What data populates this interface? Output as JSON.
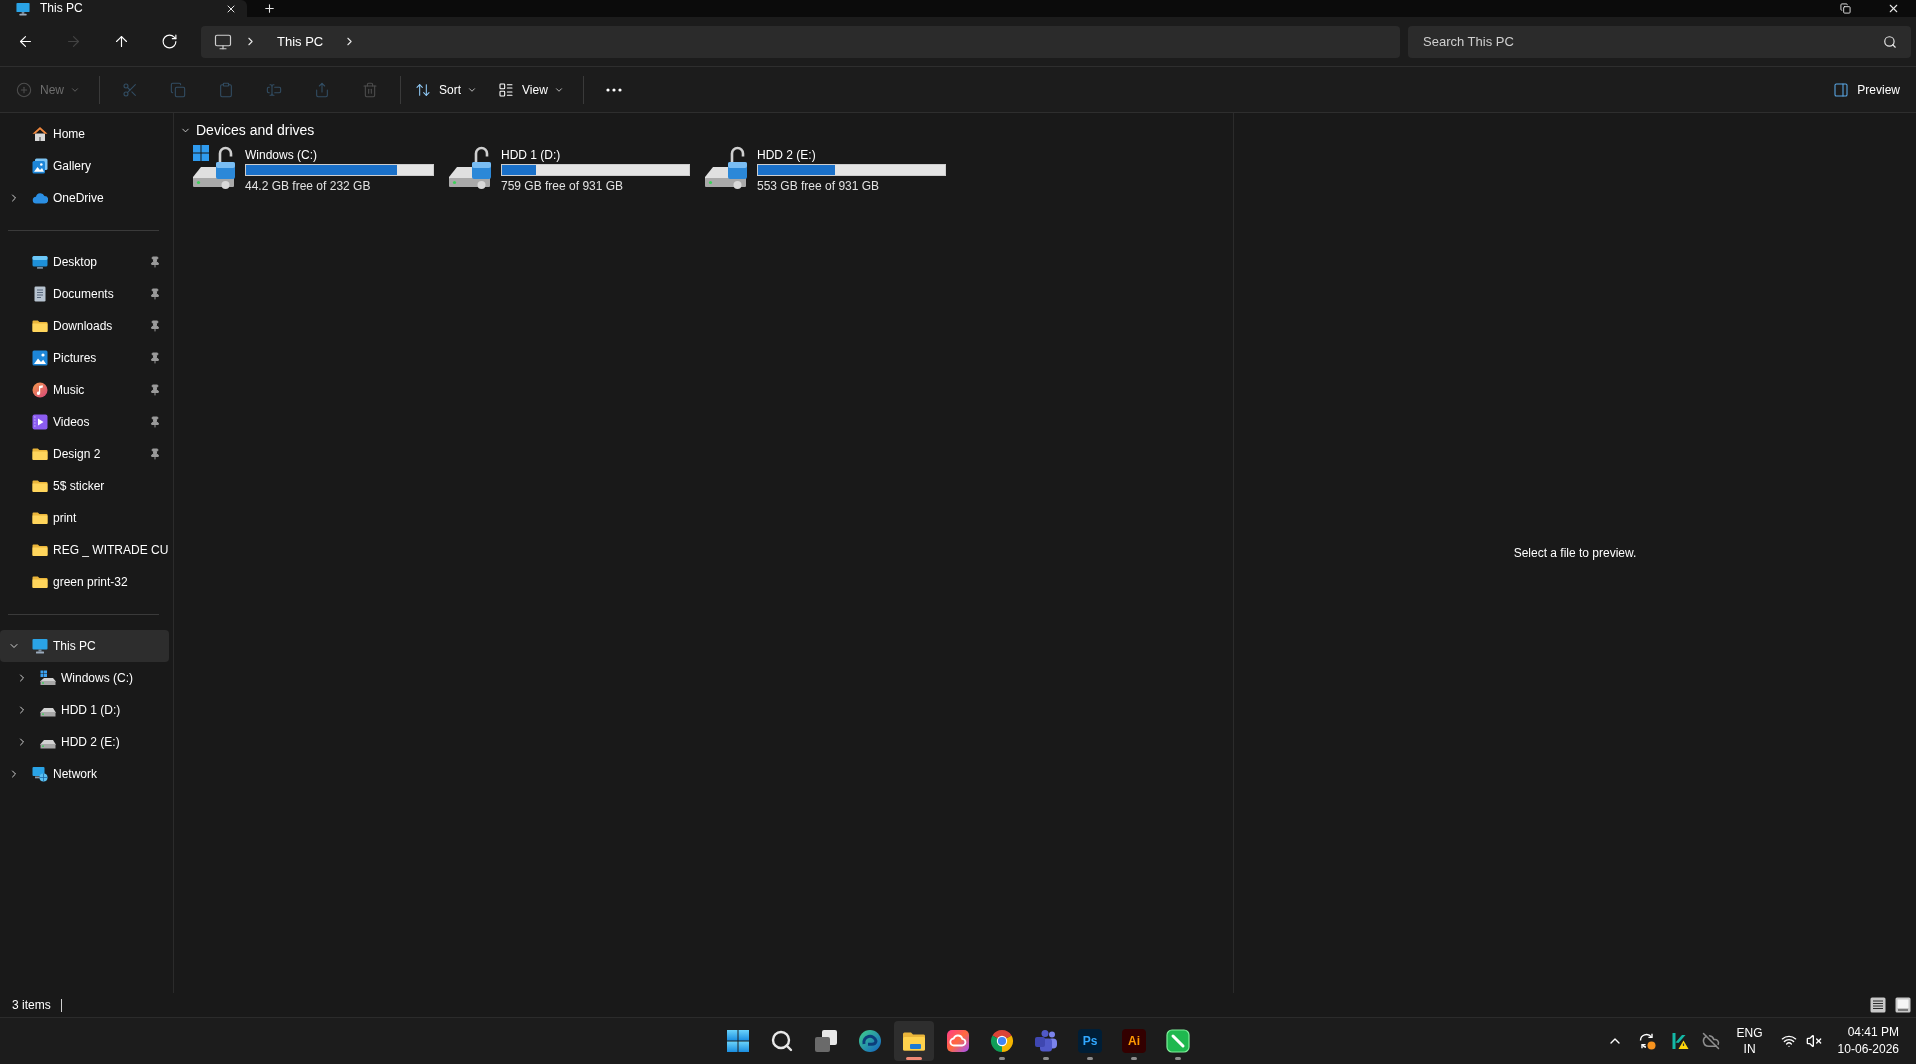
{
  "tabs": [
    {
      "title": "This PC",
      "selected": true
    }
  ],
  "navigation": [
    {
      "kind": "back",
      "disabled": false
    },
    {
      "kind": "forward",
      "disabled": true
    },
    {
      "kind": "up",
      "disabled": false
    },
    {
      "kind": "refresh",
      "disabled": false
    }
  ],
  "address_bar": {
    "segments": [
      "This PC"
    ]
  },
  "search": {
    "placeholder": "Search This PC"
  },
  "toolbar": {
    "items": [
      {
        "kind": "new",
        "label": "New",
        "disabled": true
      },
      {
        "kind": "separator"
      },
      {
        "kind": "cut",
        "disabled": true
      },
      {
        "kind": "copy",
        "disabled": true
      },
      {
        "kind": "paste",
        "disabled": true
      },
      {
        "kind": "rename",
        "disabled": true
      },
      {
        "kind": "share",
        "disabled": true
      },
      {
        "kind": "delete",
        "disabled": true
      },
      {
        "kind": "separator"
      },
      {
        "kind": "sort",
        "label": "Sort",
        "disabled": false
      },
      {
        "kind": "view",
        "label": "View",
        "disabled": false
      },
      {
        "kind": "separator"
      },
      {
        "kind": "more",
        "disabled": false
      }
    ],
    "preview": {
      "label": "Preview",
      "on": true
    }
  },
  "sidebar": {
    "sections": [
      {
        "items": [
          {
            "label": "Home",
            "kind": "home",
            "selected": false
          },
          {
            "label": "Gallery",
            "kind": "gallery",
            "selected": false
          },
          {
            "label": "OneDrive",
            "kind": "cloud",
            "expanded": false,
            "selected": false
          }
        ]
      },
      {
        "items": [
          {
            "label": "Desktop",
            "kind": "desktop",
            "pinned": true,
            "selected": false
          },
          {
            "label": "Documents",
            "kind": "documents",
            "pinned": true,
            "selected": false
          },
          {
            "label": "Downloads",
            "kind": "folder",
            "pinned": true,
            "selected": false
          },
          {
            "label": "Pictures",
            "kind": "pictures",
            "pinned": true,
            "selected": false
          },
          {
            "label": "Music",
            "kind": "music",
            "pinned": true,
            "selected": false
          },
          {
            "label": "Videos",
            "kind": "videos",
            "pinned": true,
            "selected": false
          },
          {
            "label": "Design 2",
            "kind": "folder",
            "pinned": true,
            "selected": false
          },
          {
            "label": "5$ sticker",
            "kind": "folder",
            "pinned": false,
            "selected": false
          },
          {
            "label": "print",
            "kind": "folder",
            "pinned": false,
            "selected": false
          },
          {
            "label": "REG _ WITRADE CU",
            "kind": "folder",
            "pinned": false,
            "selected": false
          },
          {
            "label": "green print-32",
            "kind": "folder",
            "pinned": false,
            "selected": false
          }
        ]
      },
      {
        "items": [
          {
            "label": "This PC",
            "kind": "pc",
            "expanded": true,
            "selected": true,
            "children": [
              {
                "label": "Windows (C:)",
                "kind": "system-drive",
                "expanded": false,
                "selected": false
              },
              {
                "label": "HDD 1 (D:)",
                "kind": "drive",
                "expanded": false,
                "selected": false
              },
              {
                "label": "HDD 2 (E:)",
                "kind": "drive",
                "expanded": false,
                "selected": false
              }
            ]
          },
          {
            "label": "Network",
            "kind": "network",
            "expanded": false,
            "selected": false
          }
        ]
      }
    ]
  },
  "content": {
    "groups": [
      {
        "title": "Devices and drives",
        "expanded": true,
        "drives": [
          {
            "name": "Windows (C:)",
            "kind": "system",
            "level": 0.81,
            "free": "44.2 GB free of 232 GB"
          },
          {
            "name": "HDD 1 (D:)",
            "kind": "data",
            "level": 0.18,
            "free": "759 GB free of 931 GB"
          },
          {
            "name": "HDD 2 (E:)",
            "kind": "data",
            "level": 0.41,
            "free": "553 GB free of 931 GB"
          }
        ]
      }
    ]
  },
  "preview_pane": {
    "message": "Select a file to preview."
  },
  "status_bar": {
    "item_count": "3 items"
  },
  "taskbar": {
    "apps": [
      {
        "kind": "start",
        "running": false,
        "selected": false
      },
      {
        "kind": "search",
        "running": false,
        "selected": false
      },
      {
        "kind": "task-view",
        "running": false,
        "selected": false
      },
      {
        "kind": "swirl-browser",
        "running": false,
        "selected": false
      },
      {
        "kind": "files",
        "running": true,
        "selected": true
      },
      {
        "kind": "cloud-suite",
        "running": false,
        "selected": false
      },
      {
        "kind": "wheel-browser",
        "running": true,
        "selected": false
      },
      {
        "kind": "chat",
        "running": true,
        "selected": false
      },
      {
        "kind": "photo-editor",
        "label": "Ps",
        "running": true,
        "selected": false
      },
      {
        "kind": "vector-editor",
        "label": "Ai",
        "running": true,
        "selected": false
      },
      {
        "kind": "pen",
        "running": true,
        "selected": false
      }
    ]
  },
  "tray": {
    "language": [
      "ENG",
      "IN"
    ],
    "volume": {
      "muted": true
    },
    "clock": {
      "time": "04:41 PM",
      "date": "10-06-2026"
    }
  }
}
